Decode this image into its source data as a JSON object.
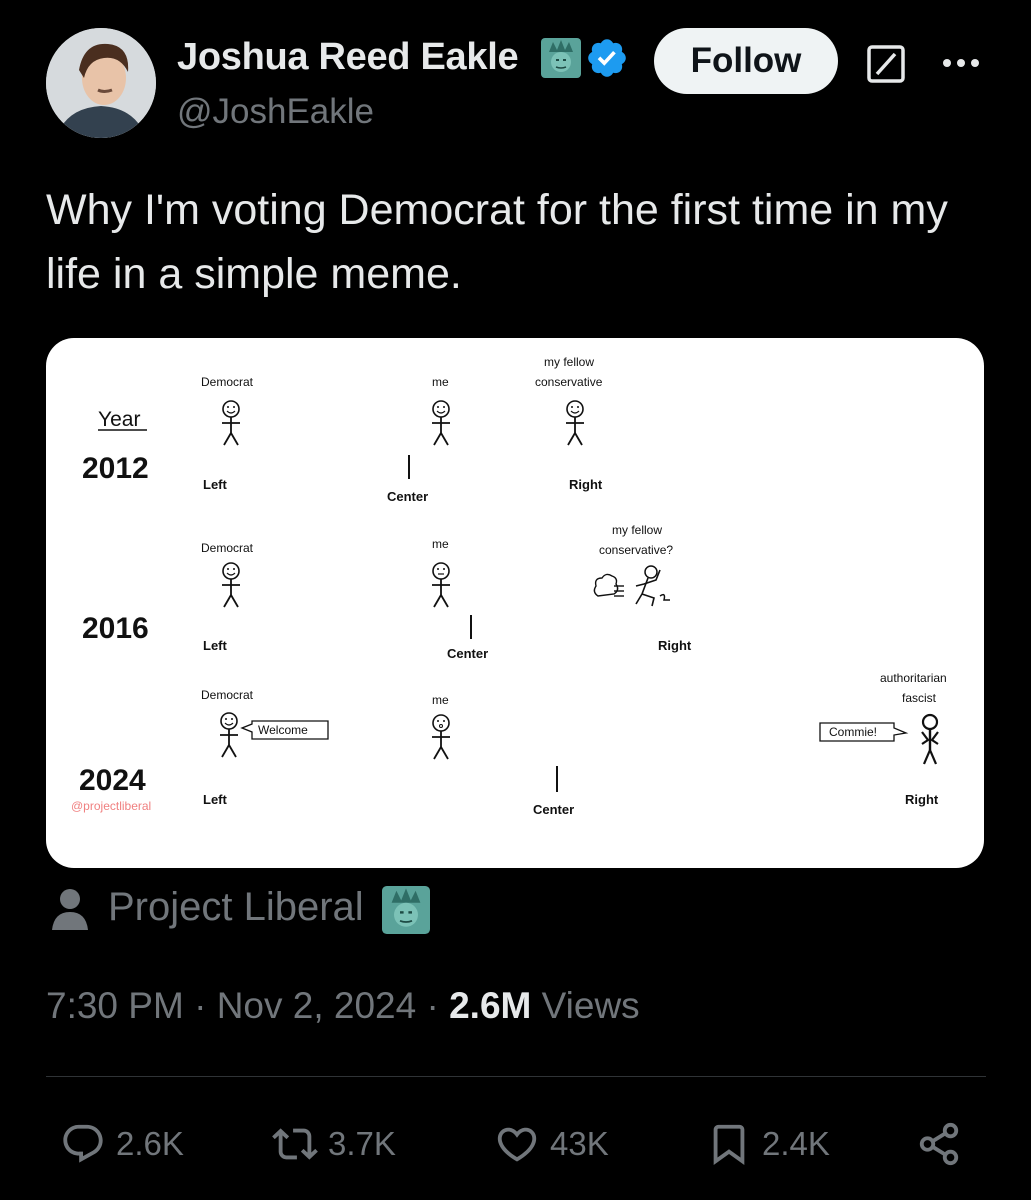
{
  "post": {
    "author_name": "Joshua Reed Eakle",
    "author_handle": "@JoshEakle",
    "follow_label": "Follow",
    "text": "Why I'm voting Democrat for the first time in my life in a simple meme.",
    "media": {
      "year_header": "Year",
      "watermark": "@projectliberal",
      "rows": [
        {
          "year": "2012",
          "left": "Left",
          "center": "Center",
          "right": "Right",
          "democrat": "Democrat",
          "me": "me",
          "fellow_line1": "my fellow",
          "fellow_line2": "conservative"
        },
        {
          "year": "2016",
          "left": "Left",
          "center": "Center",
          "right": "Right",
          "democrat": "Democrat",
          "me": "me",
          "fellow_line1": "my fellow",
          "fellow_line2": "conservative?"
        },
        {
          "year": "2024",
          "left": "Left",
          "center": "Center",
          "right": "Right",
          "democrat": "Democrat",
          "me": "me",
          "welcome": "Welcome",
          "commie": "Commie!",
          "fascist_line1": "authoritarian",
          "fascist_line2": "fascist"
        }
      ]
    },
    "attribution": "Project Liberal",
    "time": "7:30 PM",
    "date": "Nov 2, 2024",
    "views_count": "2.6M",
    "views_label": "Views",
    "separator": "·"
  },
  "actions": {
    "replies": "2.6K",
    "reposts": "3.7K",
    "likes": "43K",
    "bookmarks": "2.4K"
  },
  "icons": [
    "statue-of-liberty-icon",
    "verified-icon",
    "grok-icon",
    "more-icon",
    "person-icon",
    "reply-icon",
    "repost-icon",
    "like-icon",
    "bookmark-icon",
    "share-icon"
  ],
  "colors": {
    "background": "#000000",
    "text": "#e7e9ea",
    "muted": "#71767b",
    "verified": "#1d9bf0",
    "axis_left": "#3b5bdb",
    "axis_right": "#e03131"
  }
}
